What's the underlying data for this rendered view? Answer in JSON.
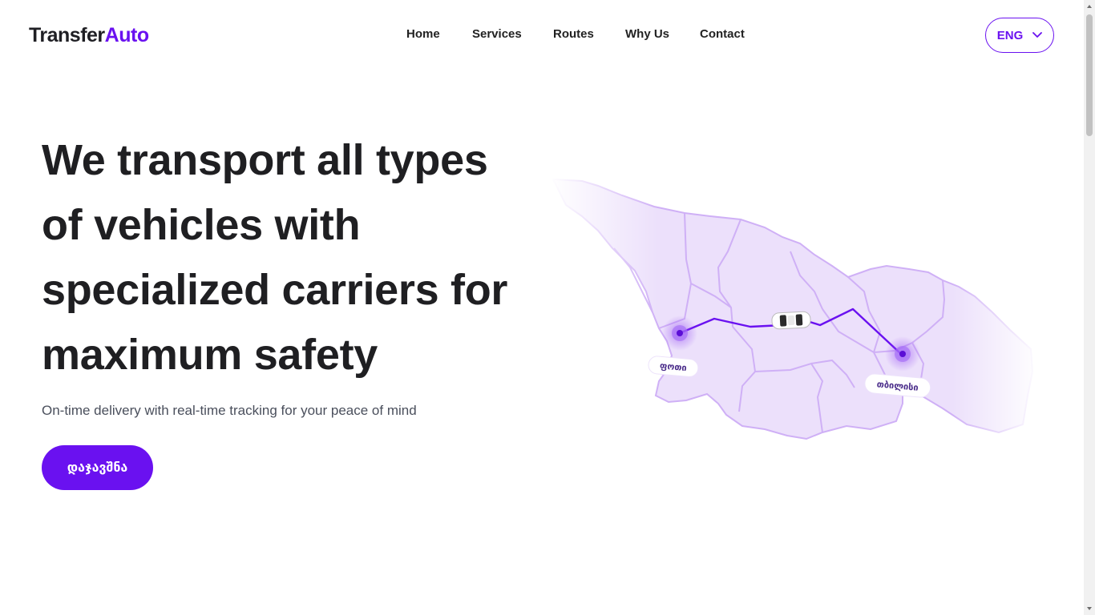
{
  "brand": {
    "name_part1": "Transfer",
    "name_part2": "Auto"
  },
  "nav": {
    "items": [
      {
        "label": "Home"
      },
      {
        "label": "Services"
      },
      {
        "label": "Routes"
      },
      {
        "label": "Why Us"
      },
      {
        "label": "Contact"
      }
    ]
  },
  "language": {
    "selected": "ENG",
    "icon": "chevron-down-icon"
  },
  "hero": {
    "title": "We transport all types of vehicles with specialized carriers for maximum safety",
    "subtitle": "On-time delivery with real-time tracking for your peace of mind",
    "cta_label": "დაჯავშნა"
  },
  "map": {
    "origin_label": "ფოთი",
    "destination_label": "თბილისი",
    "vehicle_icon": "car-icon"
  },
  "colors": {
    "accent": "#6a11f0",
    "text": "#1f1f22",
    "map_fill": "#e9dcfb",
    "map_border": "#c8a8f5"
  }
}
